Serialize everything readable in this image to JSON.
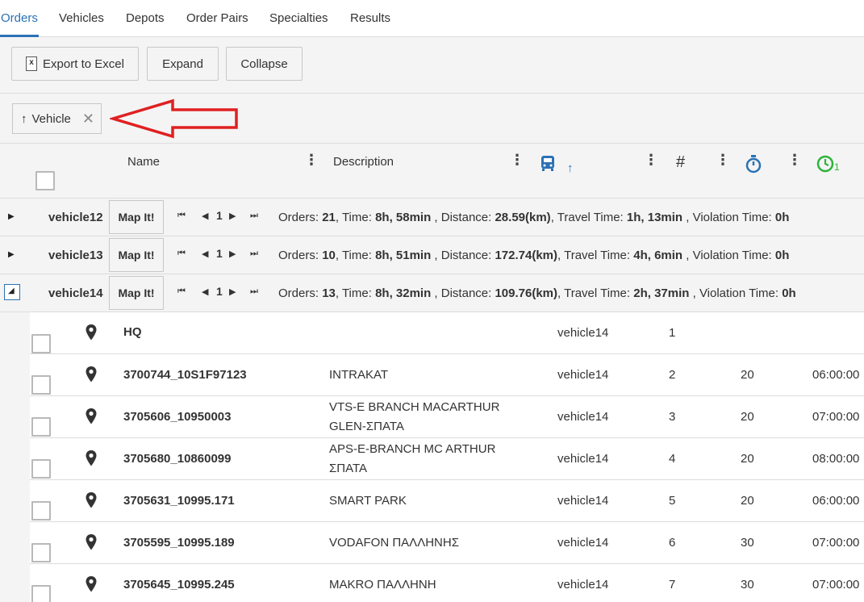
{
  "tabs": [
    "Orders",
    "Vehicles",
    "Depots",
    "Order Pairs",
    "Specialties",
    "Results"
  ],
  "toolbar": {
    "export_label": "Export to Excel",
    "expand_label": "Expand",
    "collapse_label": "Collapse"
  },
  "group_chip": {
    "label": "Vehicle",
    "arrow": "↑",
    "remove": "✕"
  },
  "header": {
    "name": "Name",
    "description": "Description",
    "hash": "#",
    "vehicle_sort_arrow": "↑",
    "clock_sub": "1"
  },
  "colors": {
    "accent": "#2a72b5",
    "green": "#2db33b",
    "red_arrow": "#e02020"
  },
  "groups": [
    {
      "vehicle": "vehicle12",
      "map": "Map It!",
      "page": "1",
      "orders": "21",
      "time": "8h, 58min",
      "distance": "28.59(km)",
      "travel": "1h, 13min",
      "violation": "0h"
    },
    {
      "vehicle": "vehicle13",
      "map": "Map It!",
      "page": "1",
      "orders": "10",
      "time": "8h, 51min",
      "distance": "172.74(km)",
      "travel": "4h, 6min",
      "violation": "0h"
    },
    {
      "vehicle": "vehicle14",
      "map": "Map It!",
      "page": "1",
      "orders": "13",
      "time": "8h, 32min",
      "distance": "109.76(km)",
      "travel": "2h, 37min",
      "violation": "0h"
    }
  ],
  "summary_labels": {
    "orders": "Orders: ",
    "time": ", Time: ",
    "distance": " , Distance: ",
    "travel": ", Travel Time: ",
    "violation": " , Violation Time: "
  },
  "rows": [
    {
      "name": "HQ",
      "desc1": "",
      "desc2": "",
      "vehicle": "vehicle14",
      "seq": "1",
      "dur": "",
      "time": ""
    },
    {
      "name": "3700744_10S1F97123",
      "desc1": "INTRAKAT",
      "desc2": "",
      "vehicle": "vehicle14",
      "seq": "2",
      "dur": "20",
      "time": "06:00:00"
    },
    {
      "name": "3705606_10950003",
      "desc1": "VTS-E BRANCH MACARTHUR",
      "desc2": "GLEN-ΣΠΑΤΑ",
      "vehicle": "vehicle14",
      "seq": "3",
      "dur": "20",
      "time": "07:00:00"
    },
    {
      "name": "3705680_10860099",
      "desc1": "APS-E-BRANCH MC ARTHUR",
      "desc2": "ΣΠΑΤΑ",
      "vehicle": "vehicle14",
      "seq": "4",
      "dur": "20",
      "time": "08:00:00"
    },
    {
      "name": "3705631_10995.171",
      "desc1": "SMART PARK",
      "desc2": "",
      "vehicle": "vehicle14",
      "seq": "5",
      "dur": "20",
      "time": "06:00:00"
    },
    {
      "name": "3705595_10995.189",
      "desc1": "VODAFON ΠΑΛΛΗΝΗΣ",
      "desc2": "",
      "vehicle": "vehicle14",
      "seq": "6",
      "dur": "30",
      "time": "07:00:00"
    },
    {
      "name": "3705645_10995.245",
      "desc1": "MAKRO ΠΑΛΛΗΝΗ",
      "desc2": "",
      "vehicle": "vehicle14",
      "seq": "7",
      "dur": "30",
      "time": "07:00:00"
    }
  ]
}
